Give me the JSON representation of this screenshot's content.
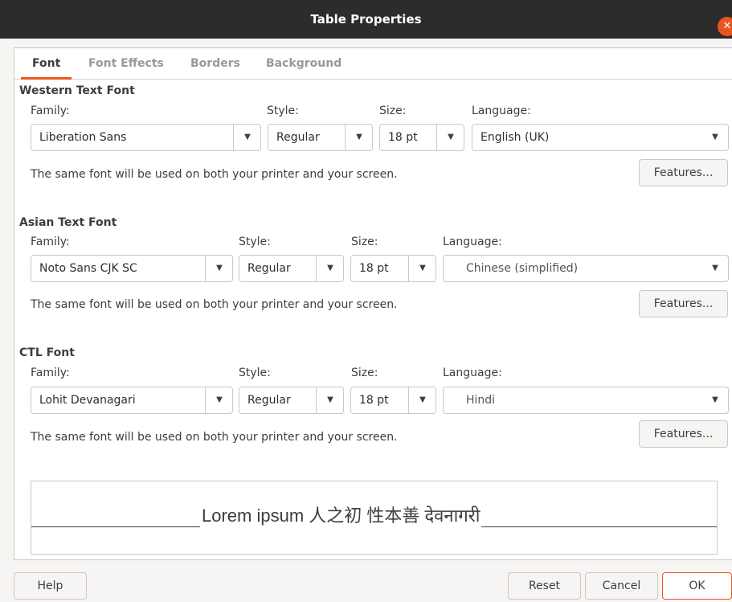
{
  "window": {
    "title": "Table Properties",
    "close_glyph": "✕"
  },
  "tabs": [
    {
      "label": "Font",
      "active": true
    },
    {
      "label": "Font Effects",
      "active": false
    },
    {
      "label": "Borders",
      "active": false
    },
    {
      "label": "Background",
      "active": false
    }
  ],
  "labels": {
    "family": "Family:",
    "style": "Style:",
    "size": "Size:",
    "language": "Language:"
  },
  "western": {
    "title": "Western Text Font",
    "family": "Liberation Sans",
    "style": "Regular",
    "size": "18 pt",
    "language": "English (UK)",
    "note": "The same font will be used on both your printer and your screen.",
    "features": "Features..."
  },
  "asian": {
    "title": "Asian Text Font",
    "family": "Noto Sans CJK SC",
    "style": "Regular",
    "size": "18 pt",
    "language": "Chinese (simplified)",
    "note": "The same font will be used on both your printer and your screen.",
    "features": "Features..."
  },
  "ctl": {
    "title": "CTL Font",
    "family": "Lohit Devanagari",
    "style": "Regular",
    "size": "18 pt",
    "language": "Hindi",
    "note": "The same font will be used on both your printer and your screen.",
    "features": "Features..."
  },
  "preview": {
    "text": "Lorem ipsum    人之初 性本善   देवनागरी"
  },
  "buttons": {
    "help": "Help",
    "reset": "Reset",
    "cancel": "Cancel",
    "ok": "OK"
  },
  "icons": {
    "dropdown": "chevron-down-icon",
    "close": "close-icon"
  },
  "colors": {
    "accent": "#e95420",
    "titlebar": "#2c2c2c"
  }
}
